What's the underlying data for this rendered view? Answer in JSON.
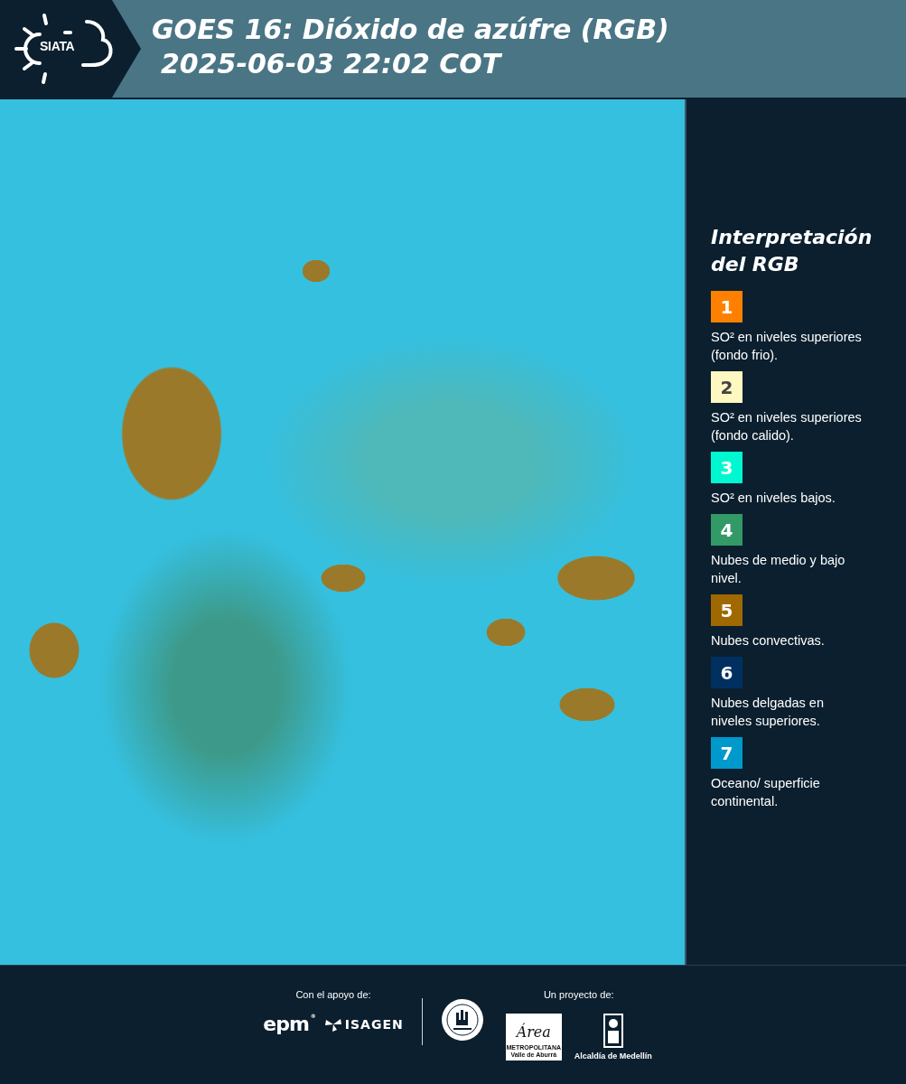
{
  "header": {
    "logo_text": "SIATA",
    "title": "GOES 16: Dióxido de azúfre (RGB)",
    "subtitle": "2025-06-03 22:02 COT"
  },
  "legend": {
    "title_lines": [
      "Interpretación",
      "del RGB"
    ],
    "items": [
      {
        "number": "1",
        "color": "#ff8000",
        "text": "SO² en niveles superiores (fondo frio)."
      },
      {
        "number": "2",
        "color": "#fff8c0",
        "text": "SO² en niveles superiores (fondo calido)."
      },
      {
        "number": "3",
        "color": "#00f8d0",
        "text": "SO² en niveles bajos."
      },
      {
        "number": "4",
        "color": "#339966",
        "text": "Nubes de medio y bajo nivel."
      },
      {
        "number": "5",
        "color": "#a06800",
        "text": "Nubes convectivas."
      },
      {
        "number": "6",
        "color": "#003060",
        "text": "Nubes delgadas en niveles superiores."
      },
      {
        "number": "7",
        "color": "#0099cc",
        "text": "Oceano/ superficie continental."
      }
    ]
  },
  "footer": {
    "support_label": "Con el apoyo de:",
    "project_label": "Un proyecto de:",
    "logos": [
      {
        "kind": "epm",
        "text": "epm",
        "mark": "®"
      },
      {
        "kind": "isagen",
        "text": "ISAGEN"
      },
      {
        "kind": "seal"
      },
      {
        "kind": "area",
        "text": "Área",
        "line1": "METROPOLITANA",
        "line2": "Valle de Aburrá"
      },
      {
        "kind": "alcaldia",
        "text": "Alcaldía de Medellín"
      }
    ]
  }
}
